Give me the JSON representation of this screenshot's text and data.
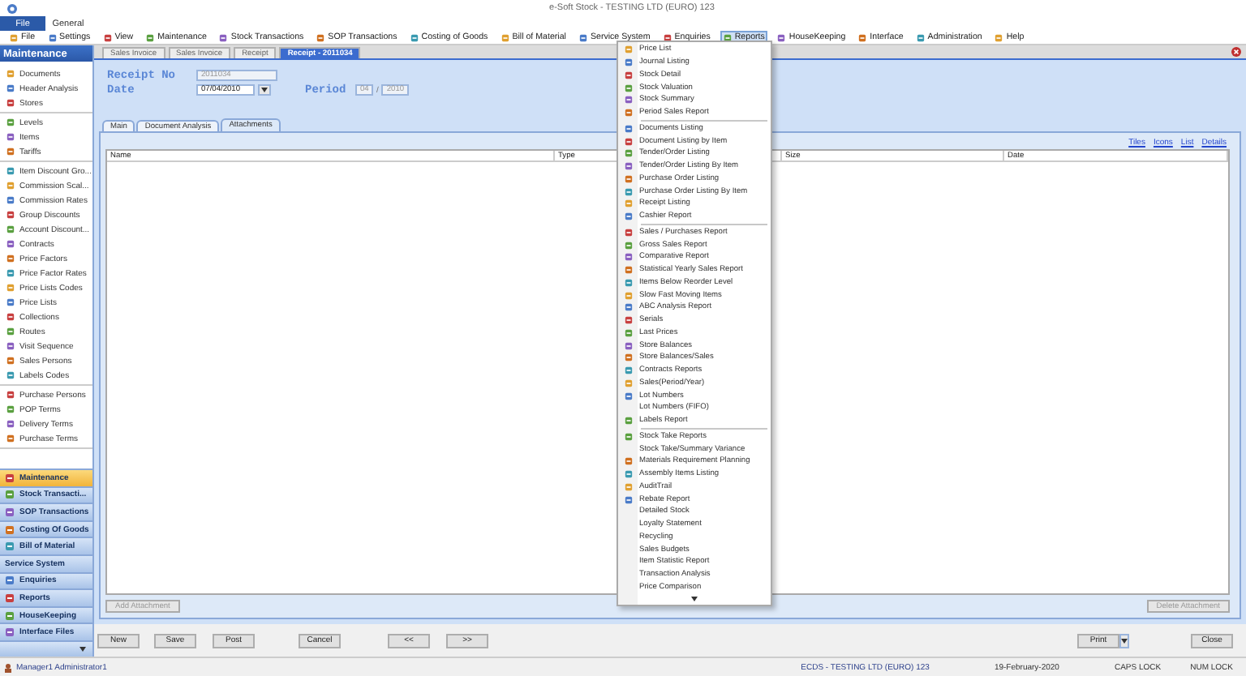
{
  "window": {
    "title": "e-Soft Stock - TESTING LTD (EURO) 123"
  },
  "ribbon_tabs": [
    {
      "label": "File",
      "selected": true
    },
    {
      "label": "General",
      "selected": false
    }
  ],
  "toolbar": [
    {
      "label": "File",
      "selected": false
    },
    {
      "label": "Settings",
      "selected": false
    },
    {
      "label": "View",
      "selected": false
    },
    {
      "label": "Maintenance",
      "selected": false
    },
    {
      "label": "Stock Transactions",
      "selected": false
    },
    {
      "label": "SOP Transactions",
      "selected": false
    },
    {
      "label": "Costing of Goods",
      "selected": false
    },
    {
      "label": "Bill of Material",
      "selected": false
    },
    {
      "label": "Service System",
      "selected": false
    },
    {
      "label": "Enquiries",
      "selected": false
    },
    {
      "label": "Reports",
      "selected": true
    },
    {
      "label": "HouseKeeping",
      "selected": false
    },
    {
      "label": "Interface",
      "selected": false
    },
    {
      "label": "Administration",
      "selected": false
    },
    {
      "label": "Help",
      "selected": false
    }
  ],
  "sidebar": {
    "title": "Maintenance",
    "sections": [
      {
        "items": [
          "Documents",
          "Header Analysis",
          "Stores"
        ]
      },
      {
        "items": [
          "Levels",
          "Items",
          "Tariffs"
        ]
      },
      {
        "items": [
          "Item Discount Gro...",
          "Commission Scal...",
          "Commission Rates",
          "Group Discounts",
          "Account Discount...",
          "Contracts",
          "Price Factors",
          "Price Factor Rates",
          "Price Lists Codes",
          "Price Lists",
          "Collections",
          "Routes",
          "Visit Sequence",
          "Sales Persons",
          "Labels Codes"
        ]
      },
      {
        "items": [
          "Purchase Persons",
          "POP Terms",
          "Delivery Terms",
          "Purchase Terms"
        ]
      }
    ],
    "nav": [
      {
        "label": "Maintenance",
        "selected": true,
        "has_icon": true
      },
      {
        "label": "Stock Transacti...",
        "selected": false,
        "has_icon": true
      },
      {
        "label": "SOP Transactions",
        "selected": false,
        "has_icon": true
      },
      {
        "label": "Costing Of Goods",
        "selected": false,
        "has_icon": true
      },
      {
        "label": "Bill of Material",
        "selected": false,
        "has_icon": true
      },
      {
        "label": "Service System",
        "selected": false,
        "has_icon": false
      },
      {
        "label": "Enquiries",
        "selected": false,
        "has_icon": true
      },
      {
        "label": "Reports",
        "selected": false,
        "has_icon": true
      },
      {
        "label": "HouseKeeping",
        "selected": false,
        "has_icon": true
      },
      {
        "label": "Interface Files",
        "selected": false,
        "has_icon": true
      }
    ]
  },
  "document_tabs": [
    {
      "label": "Sales Invoice",
      "selected": false
    },
    {
      "label": "Sales Invoice",
      "selected": false
    },
    {
      "label": "Receipt",
      "selected": false
    },
    {
      "label": "Receipt - 2011034",
      "selected": true
    }
  ],
  "form": {
    "receipt_no": {
      "label": "Receipt No",
      "value": "2011034",
      "disabled": true
    },
    "date": {
      "label": "Date",
      "value": "07/04/2010"
    },
    "period": {
      "label": "Period",
      "month": "04",
      "separator": "/",
      "year": "2010"
    }
  },
  "inner_tabs": [
    {
      "label": "Main",
      "selected": false
    },
    {
      "label": "Document Analysis",
      "selected": false
    },
    {
      "label": "Attachments",
      "selected": true
    }
  ],
  "view_links": [
    "Tiles",
    "Icons",
    "List",
    "Details"
  ],
  "table": {
    "columns": [
      "Name",
      "Type",
      "Size",
      "Date"
    ]
  },
  "attachment_buttons": [
    {
      "label": "Add Attachment",
      "disabled": true
    },
    {
      "label": "Delete Attachment",
      "disabled": true
    }
  ],
  "buttons_left": [
    "New",
    "Save",
    "Post",
    "Cancel",
    "<<",
    ">>"
  ],
  "buttons_right": [
    "Print",
    "Close"
  ],
  "reports_menu": {
    "sections": [
      {
        "items": [
          {
            "label": "Price List",
            "has_icon": true
          },
          {
            "label": "Journal Listing",
            "has_icon": true
          },
          {
            "label": "Stock Detail",
            "has_icon": true
          },
          {
            "label": "Stock Valuation",
            "has_icon": true
          },
          {
            "label": "Stock Summary",
            "has_icon": true
          },
          {
            "label": "Period Sales Report",
            "has_icon": true
          }
        ]
      },
      {
        "items": [
          {
            "label": "Documents Listing",
            "has_icon": true
          },
          {
            "label": "Document Listing by Item",
            "has_icon": true
          },
          {
            "label": "Tender/Order Listing",
            "has_icon": true
          },
          {
            "label": "Tender/Order Listing By Item",
            "has_icon": true
          },
          {
            "label": "Purchase Order Listing",
            "has_icon": true
          },
          {
            "label": "Purchase Order Listing By Item",
            "has_icon": true
          },
          {
            "label": "Receipt Listing",
            "has_icon": true
          },
          {
            "label": "Cashier Report",
            "has_icon": true
          }
        ]
      },
      {
        "items": [
          {
            "label": "Sales / Purchases Report",
            "has_icon": true
          },
          {
            "label": "Gross Sales Report",
            "has_icon": true
          },
          {
            "label": "Comparative Report",
            "has_icon": true
          },
          {
            "label": "Statistical Yearly Sales Report",
            "has_icon": true
          },
          {
            "label": "Items Below Reorder Level",
            "has_icon": true
          },
          {
            "label": "Slow Fast Moving Items",
            "has_icon": true
          },
          {
            "label": "ABC Analysis Report",
            "has_icon": true
          },
          {
            "label": "Serials",
            "has_icon": true
          },
          {
            "label": "Last Prices",
            "has_icon": true
          },
          {
            "label": "Store Balances",
            "has_icon": true
          },
          {
            "label": "Store Balances/Sales",
            "has_icon": true
          },
          {
            "label": "Contracts Reports",
            "has_icon": true
          },
          {
            "label": "Sales(Period/Year)",
            "has_icon": true
          },
          {
            "label": "Lot Numbers",
            "has_icon": true
          },
          {
            "label": "Lot Numbers (FIFO)",
            "has_icon": false
          },
          {
            "label": "Labels Report",
            "has_icon": true
          }
        ]
      },
      {
        "items": [
          {
            "label": "Stock Take Reports",
            "has_icon": true
          },
          {
            "label": "Stock Take/Summary Variance",
            "has_icon": false
          },
          {
            "label": "Materials Requirement Planning",
            "has_icon": true
          },
          {
            "label": "Assembly Items Listing",
            "has_icon": true
          },
          {
            "label": "AuditTrail",
            "has_icon": true
          },
          {
            "label": "Rebate Report",
            "has_icon": true
          },
          {
            "label": "Detailed Stock",
            "has_icon": false
          },
          {
            "label": "Loyalty Statement",
            "has_icon": false
          },
          {
            "label": "Recycling",
            "has_icon": false
          },
          {
            "label": "Sales Budgets",
            "has_icon": false
          },
          {
            "label": "Item Statistic Report",
            "has_icon": false
          },
          {
            "label": "Transaction Analysis",
            "has_icon": false
          },
          {
            "label": "Price Comparison",
            "has_icon": false
          }
        ]
      }
    ]
  },
  "status_bar": {
    "user": "Manager1 Administrator1",
    "company": "ECDS - TESTING LTD (EURO) 123",
    "date": "19-February-2020",
    "caps": "CAPS LOCK",
    "num": "NUM LOCK"
  }
}
